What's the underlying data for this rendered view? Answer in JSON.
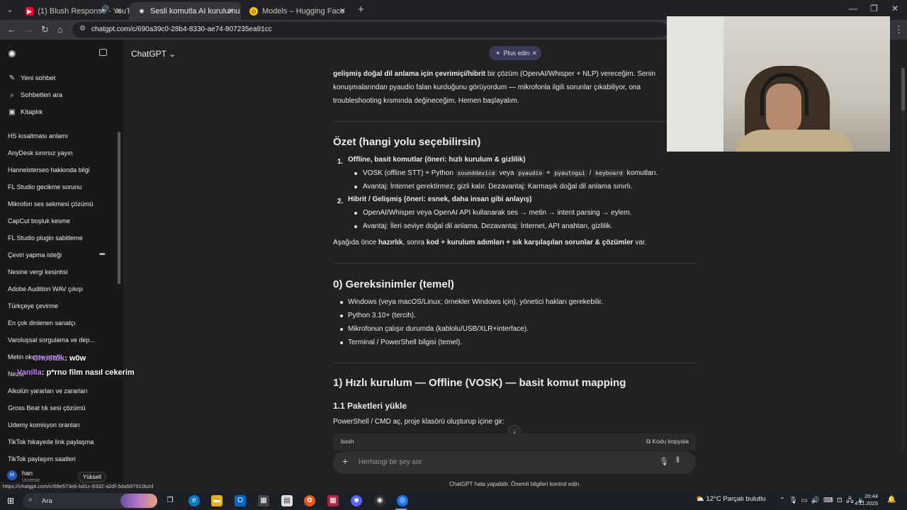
{
  "browser": {
    "tabs": [
      {
        "title": "(1) Blush Response - YouTu",
        "favicon": "youtube-icon",
        "color": "#ff0033"
      },
      {
        "title": "Sesli komutla AI kurulumu",
        "favicon": "chatgpt-icon",
        "color": "#ececec"
      },
      {
        "title": "Models – Hugging Face",
        "favicon": "huggingface-icon",
        "color": "#ffc107"
      }
    ],
    "url": "chatgpt.com/c/690a39c0-28b4-8330-ae74-807235ea91cc",
    "status_url": "https://chatgpt.com/c/68e573eb-bd1c-8332-a2df-5da597910b2d"
  },
  "sidebar": {
    "actions": [
      {
        "label": "Yeni sohbet",
        "icon": "edit-icon"
      },
      {
        "label": "Sohbetleri ara",
        "icon": "search-icon"
      },
      {
        "label": "Kitaplık",
        "icon": "library-icon"
      }
    ],
    "chats": [
      "HS kısaltması anlamı",
      "AnyDesk sınırsız yayın",
      "Hanneisterseo hakkında bilgi",
      "FL Studio gecikme sorunu",
      "Mikrofon ses sekmesi çözümü",
      "CapCut boşluk kesme",
      "FL Studio plugin sabitleme",
      "Çeviri yapma isteği",
      "Nesine vergi kesintisi",
      "Adobe Audition WAV çıkışı",
      "Türkçeye çevirme",
      "En çok dinlenen sanatçı",
      "Varoluşsal sorgulama ve dep...",
      "Metin okuma isteği",
      "Nezle",
      "Alkolün yararları ve zararları",
      "Gross Beat tık sesi çözümü",
      "Udemy komisyon oranları",
      "TikTok hikayede link paylaşma",
      "TikTok paylaşım saatleri"
    ],
    "user": {
      "name": "han",
      "plan": "Ücretsiz",
      "initial": "H",
      "upgrade_label": "Yükselt"
    }
  },
  "overlay": {
    "line1_name": "Ghostrik",
    "line1_text": ": w0w",
    "line2_name": "Vanilla",
    "line2_text": ": p*rno film nasıl cekerim"
  },
  "header": {
    "model": "ChatGPT",
    "plus_label": "Plus edin"
  },
  "article": {
    "intro_line1_bold": "gelişmiş doğal dil anlama için çevrimiçi/hibrit",
    "intro_line1_rest": " bir çözüm (OpenAI/Whisper + NLP) vereceğim. Senin",
    "intro_line2": "konuşmalarından pyaudio falan kurduğunu görüyordum — mikrofonla ilgili sorunlar çıkabiliyor, ona",
    "intro_line3": "troubleshooting kısmında değineceğim. Hemen başlayalım.",
    "sec_summary": "Özet (hangi yolu seçebilirsin)",
    "opt1_title": "Offline, basit komutlar (öneri: hızlı kurulum & gizlilik)",
    "opt1_b1_pre": "VOSK (offline STT) + Python ",
    "opt1_b1_c1": "sounddevice",
    "opt1_b1_mid": " veya ",
    "opt1_b1_c2": "pyaudio",
    "opt1_b1_plus": " + ",
    "opt1_b1_c3": "pyautogui",
    "opt1_b1_slash": " / ",
    "opt1_b1_c4": "keyboard",
    "opt1_b1_end": " komutları.",
    "opt1_b2": "Avantaj: İnternet gerektirmez; gizli kalır. Dezavantaj: Karmaşık doğal dil anlama sınırlı.",
    "opt2_title": "Hibrit / Gelişmiş (öneri: esnek, daha insan gibi anlayış)",
    "opt2_b1": "OpenAI/Whisper veya OpenAI API kullanarak ses → metin → intent parsing → eylem.",
    "opt2_b2": "Avantaj: İleri seviye doğal dil anlama. Dezavantaj: İnternet, API anahtarı, gizlilik.",
    "below_pre": "Aşağıda önce ",
    "below_b1": "hazırlık",
    "below_mid1": ", sonra ",
    "below_b2": "kod + kurulum adımları + sık karşılaşılan sorunlar & çözümler",
    "below_end": " var.",
    "sec_req": "0) Gereksinimler (temel)",
    "req": [
      "Windows (veya macOS/Linux; örnekler Windows için), yönetici hakları gerekebilir.",
      "Python 3.10+ (tercih).",
      "Mikrofonun çalışır durumda (kablolu/USB/XLR+interface).",
      "Terminal / PowerShell bilgisi (temel)."
    ],
    "sec_quick": "1) Hızlı kurulum — Offline (VOSK) — basit komut mapping",
    "sub_install": "1.1 Paketleri yükle",
    "install_text": "PowerShell / CMD aç, proje klasörü oluşturup içine gir:"
  },
  "code_block": {
    "lang": "bash",
    "copy_label": "Kodu kopyala"
  },
  "composer": {
    "placeholder": "Herhangi bir şey sor",
    "disclaimer": "ChatGPT hata yapabilir. Önemli bilgileri kontrol edin."
  },
  "taskbar": {
    "search_label": "Ara",
    "weather": "12°C  Parçalı bulutlu",
    "time": "20:44",
    "date": "4.11.2025"
  }
}
